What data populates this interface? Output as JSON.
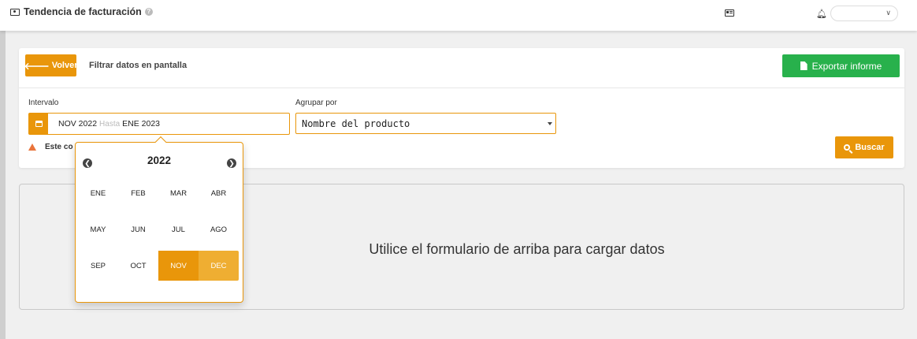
{
  "header": {
    "title": "Tendencia de facturación",
    "help_icon": "?",
    "icons": [
      "money-icon",
      "help-icon",
      "id-card-icon",
      "bell-icon",
      "chevron-down-icon"
    ]
  },
  "toolbar": {
    "back_label": "Volver",
    "filter_title": "Filtrar datos en pantalla",
    "export_label": "Exportar informe"
  },
  "form": {
    "interval_label": "Intervalo",
    "date_from": "NOV 2022",
    "date_separator": "Hasta",
    "date_to": "ENE 2023",
    "group_label": "Agrupar por",
    "group_value": "Nombre del producto",
    "warning_text": "Este co",
    "search_label": "Buscar"
  },
  "main": {
    "empty_message": "Utilice el formulario de arriba para cargar datos"
  },
  "month_picker": {
    "year": "2022",
    "months": [
      "ENE",
      "FEB",
      "MAR",
      "ABR",
      "MAY",
      "JUN",
      "JUL",
      "AGO",
      "SEP",
      "OCT",
      "NOV",
      "DEC"
    ],
    "selected_start": "NOV",
    "selected_range": [
      "DEC"
    ]
  },
  "colors": {
    "accent": "#e9960a",
    "success": "#28b14c",
    "warning": "#e9743b"
  }
}
